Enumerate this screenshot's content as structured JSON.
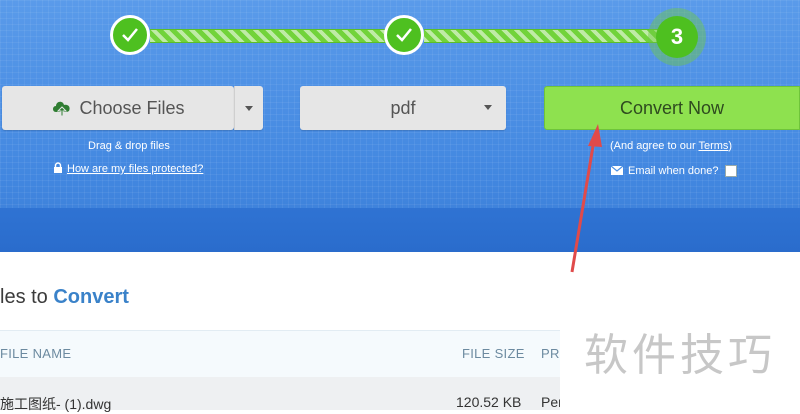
{
  "steps": {
    "step1_icon": "check-icon",
    "step2_icon": "check-icon",
    "step3_number": "3",
    "bar_color": "#72d33a",
    "circle_color": "#4ec020"
  },
  "upload": {
    "choose_files_label": "Choose Files",
    "drag_drop_text": "Drag & drop files",
    "protected_link": "How are my files protected?"
  },
  "format": {
    "selected": "pdf"
  },
  "convert": {
    "button_label": "Convert Now",
    "agree_prefix": "(And agree to our ",
    "terms_link": "Terms",
    "agree_suffix": ")",
    "email_label": "Email when done?",
    "button_color": "#8ee14f"
  },
  "files_section": {
    "title_prefix": "les to ",
    "title_accent": "Convert",
    "columns": {
      "file_name": "FILE NAME",
      "file_size": "FILE SIZE",
      "progress": "PRO"
    },
    "rows": [
      {
        "name": "施工图纸- (1).dwg",
        "size": "120.52 KB",
        "progress": "Pen"
      }
    ]
  },
  "watermark_text": "软件技巧",
  "annotation_color": "#e04a4a"
}
